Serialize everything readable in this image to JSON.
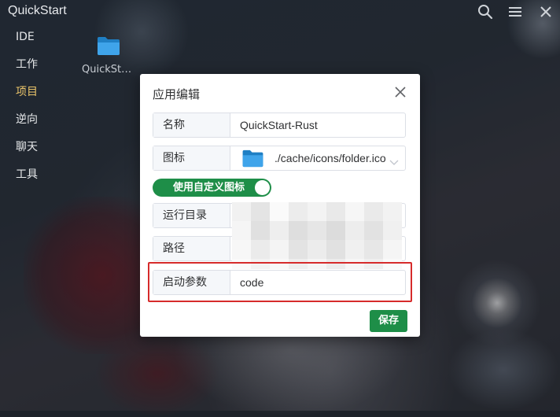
{
  "app": {
    "title": "QuickStart"
  },
  "sidebar": {
    "items": [
      {
        "label": "IDE",
        "active": false
      },
      {
        "label": "工作",
        "active": false
      },
      {
        "label": "项目",
        "active": true
      },
      {
        "label": "逆向",
        "active": false
      },
      {
        "label": "聊天",
        "active": false
      },
      {
        "label": "工具",
        "active": false
      }
    ],
    "active_color": "#e9c46a"
  },
  "desktop": {
    "items": [
      {
        "label": "QuickStart-Rust",
        "icon": "folder-icon"
      }
    ]
  },
  "dialog": {
    "title": "应用编辑",
    "fields": {
      "name": {
        "label": "名称",
        "value": "QuickStart-Rust"
      },
      "icon": {
        "label": "图标",
        "value": "./cache/icons/folder.ico"
      },
      "workdir": {
        "label": "运行目录",
        "value": ""
      },
      "path": {
        "label": "路径",
        "value": ""
      },
      "args": {
        "label": "启动参数",
        "value": "code"
      }
    },
    "custom_icon_toggle": {
      "label": "使用自定义图标",
      "on": true
    },
    "save_label": "保存"
  },
  "colors": {
    "accent_green": "#1e8e48",
    "highlight_red": "#d62b2b"
  }
}
